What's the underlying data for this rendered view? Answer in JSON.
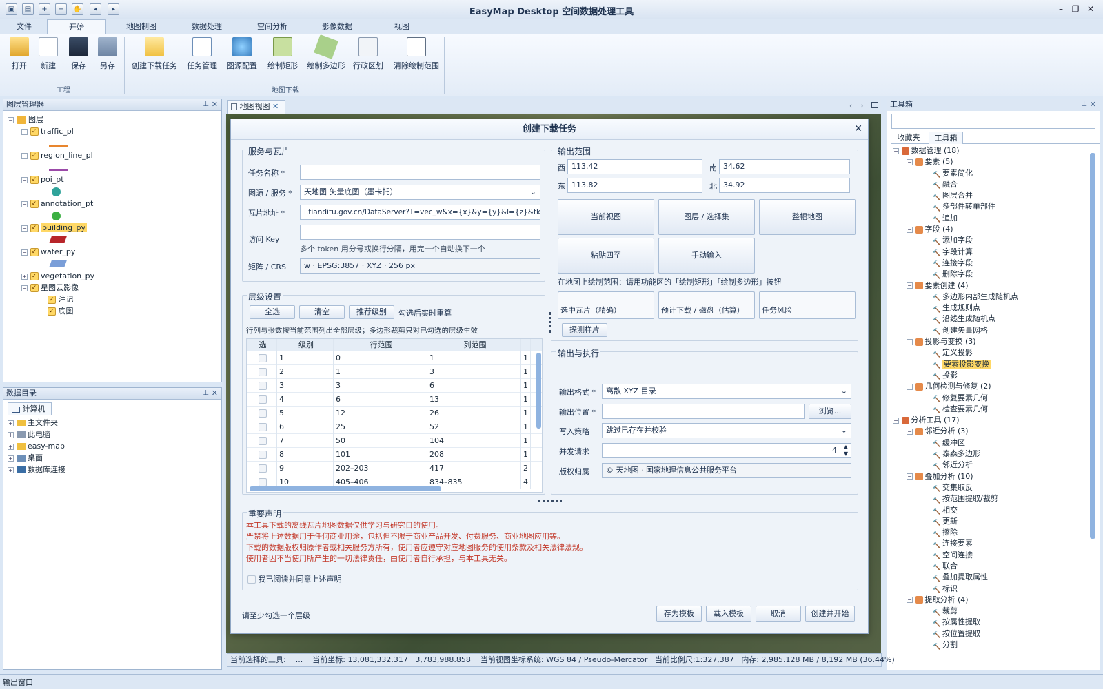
{
  "app": {
    "title": "EasyMap Desktop 空间数据处理工具"
  },
  "menu": {
    "tabs": [
      "文件",
      "开始",
      "地图制图",
      "数据处理",
      "空间分析",
      "影像数据",
      "视图"
    ],
    "active": "开始"
  },
  "ribbon": {
    "project_buttons": [
      "打开",
      "新建",
      "保存",
      "另存"
    ],
    "download_buttons": [
      "创建下载任务",
      "任务管理",
      "图源配置",
      "绘制矩形",
      "绘制多边形",
      "行政区划",
      "清除绘制范围"
    ],
    "group_project": "工程",
    "group_download": "地图下载"
  },
  "layer_manager": {
    "title": "图层管理器",
    "root": "图层",
    "layers": [
      "traffic_pl",
      "region_line_pl",
      "poi_pt",
      "annotation_pt",
      "building_py",
      "water_py",
      "vegetation_py",
      "星图云影像"
    ],
    "sublayers": [
      "注记",
      "底图"
    ],
    "selected": "building_py"
  },
  "catalog": {
    "title": "数据目录",
    "tab": "计算机",
    "items": [
      "主文件夹",
      "此电脑",
      "easy-map",
      "桌面",
      "数据库连接"
    ]
  },
  "map_tab": {
    "label": "地图视图"
  },
  "dialog": {
    "title": "创建下载任务",
    "service": {
      "section": "服务与瓦片",
      "name_label": "任务名称 *",
      "name_value": "",
      "source_label": "图源 / 服务 *",
      "source_value": "天地图 矢量底图（墨卡托）",
      "url_label": "瓦片地址 *",
      "url_value": "i.tianditu.gov.cn/DataServer?T=vec_w&x={x}&y={y}&l={z}&tk={key}",
      "key_label": "访问 Key",
      "key_value": "",
      "key_hint": "多个 token 用分号或换行分隔，用完一个自动换下一个",
      "crs_label": "矩阵 / CRS",
      "crs_value": "w · EPSG:3857 · XYZ · 256 px"
    },
    "levels": {
      "section": "层级设置",
      "btn_all": "全选",
      "btn_clear": "清空",
      "btn_recommend": "推荐级别",
      "tip_recalc": "勾选后实时重算",
      "hint": "行列与张数按当前范围列出全部层级；多边形裁剪只对已勾选的层级生效",
      "columns": [
        "选",
        "级别",
        "行范围",
        "列范围"
      ],
      "rows": [
        [
          "1",
          "0",
          "1",
          "1"
        ],
        [
          "2",
          "1",
          "3",
          "1"
        ],
        [
          "3",
          "3",
          "6",
          "1"
        ],
        [
          "4",
          "6",
          "13",
          "1"
        ],
        [
          "5",
          "12",
          "26",
          "1"
        ],
        [
          "6",
          "25",
          "52",
          "1"
        ],
        [
          "7",
          "50",
          "104",
          "1"
        ],
        [
          "8",
          "101",
          "208",
          "1"
        ],
        [
          "9",
          "202–203",
          "417",
          "2"
        ],
        [
          "10",
          "405–406",
          "834–835",
          "4"
        ]
      ]
    },
    "extent": {
      "section": "输出范围",
      "west_label": "西",
      "west": "113.42",
      "south_label": "南",
      "south": "34.62",
      "east_label": "东",
      "east": "113.82",
      "north_label": "北",
      "north": "34.92",
      "btn_current": "当前视图",
      "btn_layer": "图层 / 选择集",
      "btn_world": "整幅地图",
      "btn_paste": "粘贴四至",
      "btn_manual": "手动输入",
      "hint": "在地图上绘制范围：请用功能区的「绘制矩形」「绘制多边形」按钮",
      "stat_value": "--",
      "stat_tiles": "选中瓦片（精确）",
      "stat_disk": "预计下载 / 磁盘（估算）",
      "stat_risk": "任务风险",
      "btn_probe": "探测样片"
    },
    "output": {
      "section": "输出与执行",
      "format_label": "输出格式 *",
      "format_value": "离散 XYZ 目录",
      "location_label": "输出位置 *",
      "location_value": "",
      "browse": "浏览...",
      "policy_label": "写入策略",
      "policy_value": "跳过已存在并校验",
      "concurrency_label": "并发请求",
      "concurrency_value": "4",
      "copyright_label": "版权归属",
      "copyright_value": "© 天地图 · 国家地理信息公共服务平台"
    },
    "notice": {
      "section": "重要声明",
      "lines": [
        "本工具下载的离线瓦片地图数据仅供学习与研究目的使用。",
        "严禁将上述数据用于任何商业用途，包括但不限于商业产品开发、付费服务、商业地图应用等。",
        "下载的数据版权归原作者或相关服务方所有，使用者应遵守对应地图服务的使用条款及相关法律法规。",
        "使用者因不当使用所产生的一切法律责任，由使用者自行承担，与本工具无关。"
      ],
      "agree": "我已阅读并同意上述声明"
    },
    "footer": {
      "status": "请至少勾选一个层级",
      "save_template": "存为模板",
      "load_template": "载入模板",
      "cancel": "取消",
      "create": "创建并开始"
    }
  },
  "toolbox": {
    "title": "工具箱",
    "tabs": [
      "收藏夹",
      "工具箱"
    ],
    "active_tab": "工具箱",
    "tree": [
      {
        "level": 0,
        "text": "数据管理 (18)"
      },
      {
        "level": 1,
        "text": "要素 (5)"
      },
      {
        "level": 2,
        "text": "要素简化"
      },
      {
        "level": 2,
        "text": "融合"
      },
      {
        "level": 2,
        "text": "图层合并"
      },
      {
        "level": 2,
        "text": "多部件转单部件"
      },
      {
        "level": 2,
        "text": "追加"
      },
      {
        "level": 1,
        "text": "字段 (4)"
      },
      {
        "level": 2,
        "text": "添加字段"
      },
      {
        "level": 2,
        "text": "字段计算"
      },
      {
        "level": 2,
        "text": "连接字段"
      },
      {
        "level": 2,
        "text": "删除字段"
      },
      {
        "level": 1,
        "text": "要素创建 (4)"
      },
      {
        "level": 2,
        "text": "多边形内部生成随机点"
      },
      {
        "level": 2,
        "text": "生成规则点"
      },
      {
        "level": 2,
        "text": "沿线生成随机点"
      },
      {
        "level": 2,
        "text": "创建矢量网格"
      },
      {
        "level": 1,
        "text": "投影与变换 (3)"
      },
      {
        "level": 2,
        "text": "定义投影"
      },
      {
        "level": 2,
        "text": "要素投影变换",
        "selected": true
      },
      {
        "level": 2,
        "text": "投影"
      },
      {
        "level": 1,
        "text": "几何检测与修复 (2)"
      },
      {
        "level": 2,
        "text": "修复要素几何"
      },
      {
        "level": 2,
        "text": "检查要素几何"
      },
      {
        "level": 0,
        "text": "分析工具 (17)"
      },
      {
        "level": 1,
        "text": "邻近分析 (3)"
      },
      {
        "level": 2,
        "text": "缓冲区"
      },
      {
        "level": 2,
        "text": "泰森多边形"
      },
      {
        "level": 2,
        "text": "邻近分析"
      },
      {
        "level": 1,
        "text": "叠加分析 (10)"
      },
      {
        "level": 2,
        "text": "交集取反"
      },
      {
        "level": 2,
        "text": "按范围提取/裁剪"
      },
      {
        "level": 2,
        "text": "相交"
      },
      {
        "level": 2,
        "text": "更新"
      },
      {
        "level": 2,
        "text": "擦除"
      },
      {
        "level": 2,
        "text": "连接要素"
      },
      {
        "level": 2,
        "text": "空间连接"
      },
      {
        "level": 2,
        "text": "联合"
      },
      {
        "level": 2,
        "text": "叠加提取属性"
      },
      {
        "level": 2,
        "text": "标识"
      },
      {
        "level": 1,
        "text": "提取分析 (4)"
      },
      {
        "level": 2,
        "text": "裁剪"
      },
      {
        "level": 2,
        "text": "按属性提取"
      },
      {
        "level": 2,
        "text": "按位置提取"
      },
      {
        "level": 2,
        "text": "分割"
      }
    ]
  },
  "statusbar": {
    "tool_label": "当前选择的工具:",
    "tool_value": "...",
    "coord_label": "当前坐标:",
    "coord_x": "13,081,332.317",
    "coord_y": "3,783,988.858",
    "crs_label": "当前视图坐标系统:",
    "crs_value": "WGS 84 / Pseudo-Mercator",
    "scale_label": "当前比例尺:",
    "scale_value": "1:327,387",
    "mem_label": "内存:",
    "mem_value": "2,985.128 MB / 8,192 MB (36.44%)"
  },
  "output_window": {
    "label": "输出窗口"
  },
  "colors": {
    "accent": "#3a6ea5",
    "selected": "#ffd866",
    "notice_red": "#c33a2b",
    "map_green": "#4b5e3a"
  }
}
